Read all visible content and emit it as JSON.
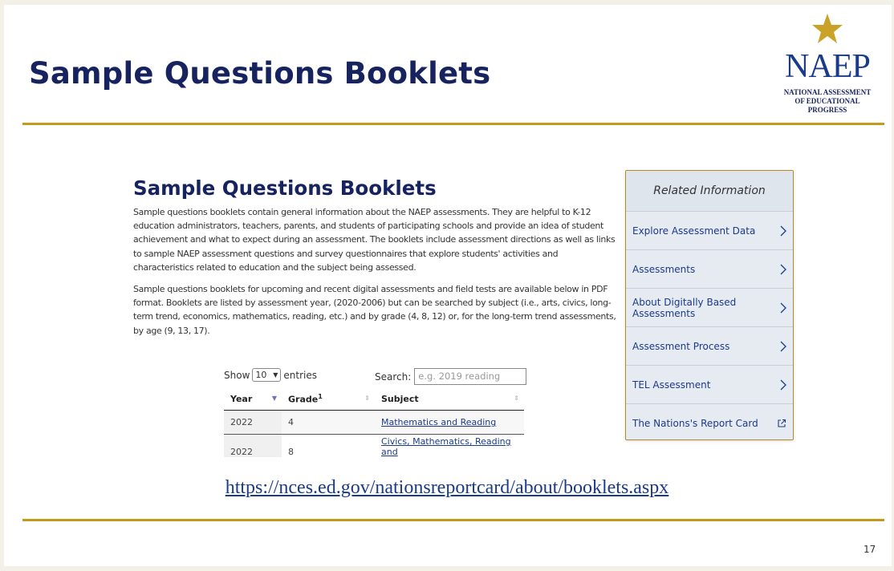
{
  "slide": {
    "title": "Sample Questions Booklets",
    "url": "https://nces.ed.gov/nationsreportcard/about/booklets.aspx",
    "page_number": "17"
  },
  "logo": {
    "word": "NAEP",
    "subtitle_lines": [
      "NATIONAL ASSESSMENT",
      "OF EDUCATIONAL",
      "PROGRESS"
    ],
    "colors": {
      "star": "#c9a227",
      "word": "#1a3a8a"
    }
  },
  "embed": {
    "title": "Sample Questions Booklets",
    "paragraph1": "Sample questions booklets contain general information about the NAEP assessments. They are helpful to K-12 education administrators, teachers, parents, and students of participating schools and provide an idea of student achievement and what to expect during an assessment. The booklets include assessment directions as well as links to sample NAEP assessment questions and survey questionnaires that explore students' activities and characteristics related to education and the subject being assessed.",
    "paragraph2": "Sample questions booklets for upcoming and recent digital assessments and field tests are available below in PDF format. Booklets are listed by assessment year, (2020-2006) but can be searched by subject (i.e., arts, civics, long-term trend, economics, mathematics, reading, etc.) and by grade (4, 8, 12) or, for the long-term trend assessments, by age (9, 13, 17)."
  },
  "datatable": {
    "show_label": "Show",
    "entries_value": "10",
    "entries_label": "entries",
    "search_label": "Search:",
    "search_placeholder": "e.g. 2019 reading",
    "columns": {
      "year": "Year",
      "grade": "Grade",
      "grade_sup": "1",
      "subject": "Subject"
    },
    "rows": [
      {
        "year": "2022",
        "grade": "4",
        "subject": "Mathematics and Reading"
      },
      {
        "year": "2022",
        "grade": "8",
        "subject": "Civics, Mathematics, Reading and"
      }
    ]
  },
  "related": {
    "heading": "Related Information",
    "items": [
      {
        "label": "Explore Assessment Data",
        "icon": "chevron-right-icon"
      },
      {
        "label": "Assessments",
        "icon": "chevron-right-icon"
      },
      {
        "label": "About Digitally Based Assessments",
        "icon": "chevron-right-icon"
      },
      {
        "label": "Assessment Process",
        "icon": "chevron-right-icon"
      },
      {
        "label": "TEL Assessment",
        "icon": "chevron-right-icon"
      },
      {
        "label": "The Nations's Report Card",
        "icon": "external-link-icon"
      }
    ]
  },
  "colors": {
    "title": "#16235f",
    "rule": "#c49a1c",
    "link": "#1a3a8a"
  }
}
